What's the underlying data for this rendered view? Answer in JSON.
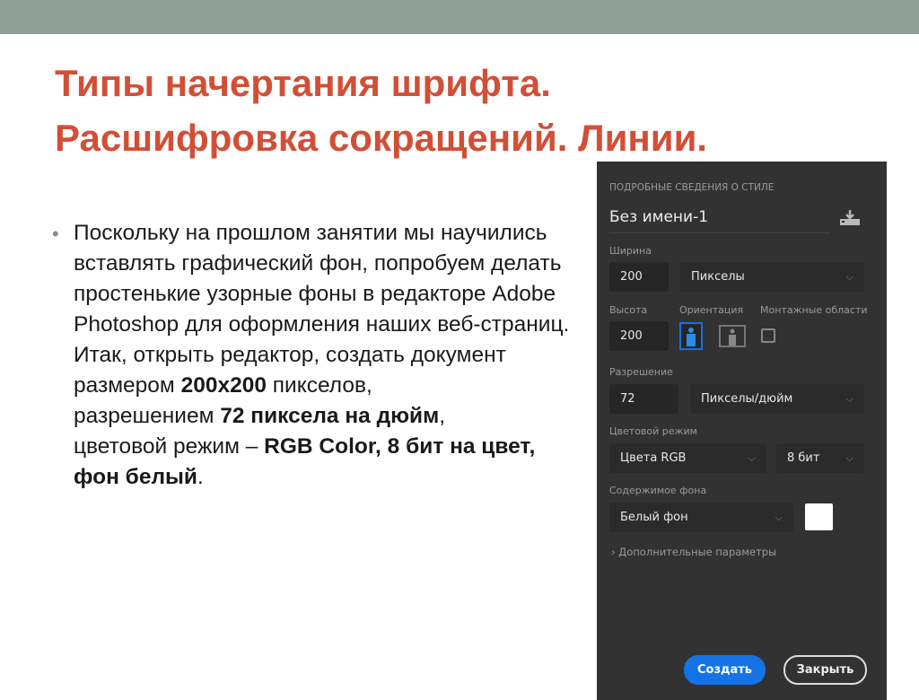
{
  "slide": {
    "title_line1": "Типы начертания шрифта.",
    "title_line2": "Расшифровка сокращений. Линии.",
    "bullet": "•",
    "p1": "Поскольку на прошлом занятии мы научились вставлять графический фон, попробуем делать простенькие узорные фоны в редакторе Adobe Photoshop для оформления наших веб-страниц.",
    "p2": "Итак, открыть редактор, создать документ",
    "p3a": "размером ",
    "p3b": "200х200",
    "p3c": " пикселов,",
    "p4a": "разрешением ",
    "p4b": "72 пиксела на дюйм",
    "p4c": ",",
    "p5a": "цветовой режим – ",
    "p5b": "RGB Color, 8 бит на цвет, фон белый",
    "p5c": "."
  },
  "panel": {
    "header": "ПОДРОБНЫЕ СВЕДЕНИЯ О СТИЛЕ",
    "doc_name": "Без имени-1",
    "width_label": "Ширина",
    "width_value": "200",
    "width_unit": "Пикселы",
    "height_label": "Высота",
    "height_value": "200",
    "orientation_label": "Ориентация",
    "artboards_label": "Монтажные области",
    "resolution_label": "Разрешение",
    "resolution_value": "72",
    "resolution_unit": "Пикселы/дюйм",
    "color_mode_label": "Цветовой режим",
    "color_mode": "Цвета RGB",
    "bit_depth": "8 бит",
    "bg_label": "Содержимое фона",
    "bg_value": "Белый фон",
    "bg_color": "#ffffff",
    "advanced": "Дополнительные параметры",
    "create": "Создать",
    "close": "Закрыть",
    "accent": "#1473e6"
  }
}
